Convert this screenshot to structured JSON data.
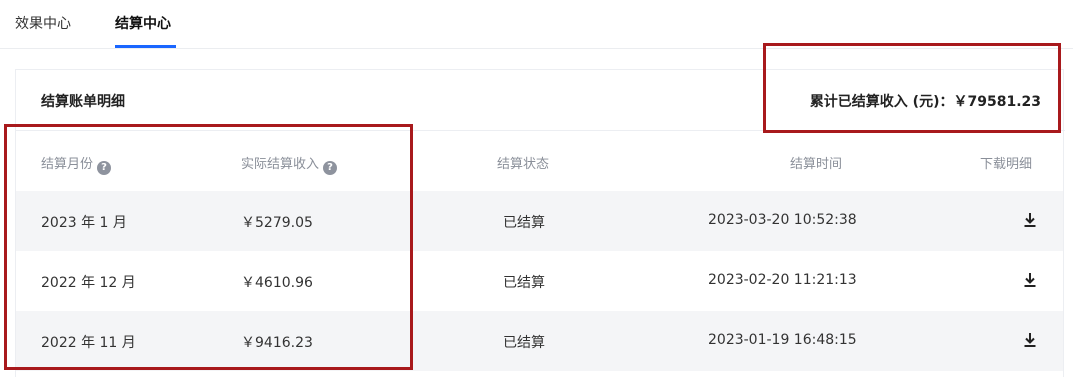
{
  "tabs": [
    {
      "label": "效果中心"
    },
    {
      "label": "结算中心"
    }
  ],
  "card": {
    "title": "结算账单明细",
    "total_label": "累计已结算收入 (元)：￥79581.23"
  },
  "table": {
    "columns": [
      {
        "label": "结算月份",
        "help": "?"
      },
      {
        "label": "实际结算收入",
        "help": "?"
      },
      {
        "label": "结算状态"
      },
      {
        "label": "结算时间"
      },
      {
        "label": "下载明细"
      }
    ],
    "rows": [
      {
        "month": "2023 年 1 月",
        "amount": "￥5279.05",
        "status": "已结算",
        "time": "2023-03-20 10:52:38"
      },
      {
        "month": "2022 年 12 月",
        "amount": "￥4610.96",
        "status": "已结算",
        "time": "2023-02-20 11:21:13"
      },
      {
        "month": "2022 年 11 月",
        "amount": "￥9416.23",
        "status": "已结算",
        "time": "2023-01-19 16:48:15"
      }
    ]
  },
  "colors": {
    "accent": "#1a66ff",
    "highlight_box": "#a8191c",
    "row_shade": "#f4f5f7"
  },
  "icons": {
    "help": "question-circle-icon",
    "download": "download-icon"
  }
}
